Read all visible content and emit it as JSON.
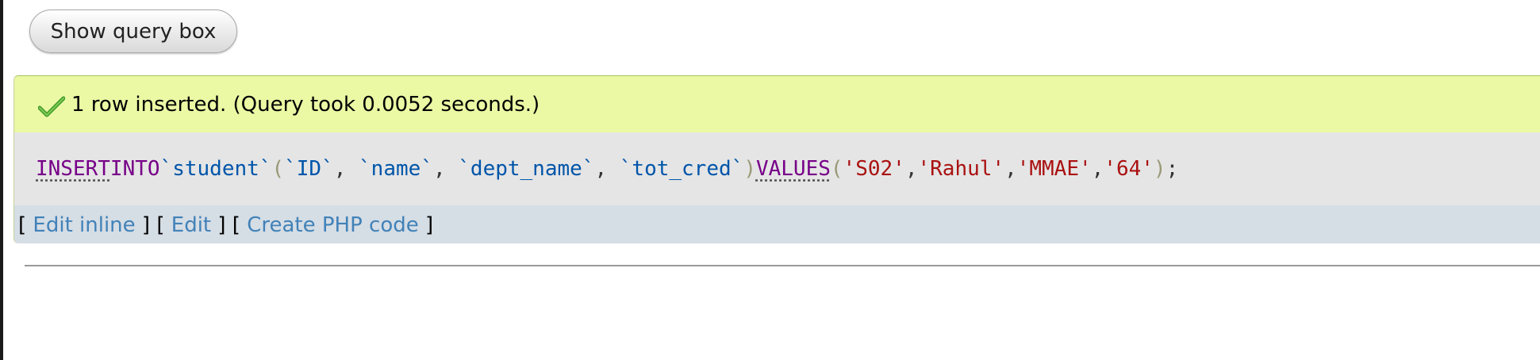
{
  "toolbar": {
    "show_query_label": "Show query box"
  },
  "result": {
    "success_message": "1 row inserted. (Query took 0.0052 seconds.)",
    "sql": {
      "kw_insert": "INSERT",
      "kw_into": "INTO",
      "table": "`student`",
      "open_paren": "(",
      "col1": "`ID`",
      "col2": "`name`",
      "col3": "`dept_name`",
      "col4": "`tot_cred`",
      "close_paren": ")",
      "kw_values": "VALUES",
      "val1": "'S02'",
      "val2": "'Rahul'",
      "val3": "'MMAE'",
      "val4": "'64'",
      "comma": ",",
      "comma_space": ", ",
      "terminator": ";"
    },
    "links": {
      "open_bracket": "[ ",
      "close_bracket": " ]",
      "separator": " ] [ ",
      "edit_inline": "Edit inline",
      "edit": "Edit",
      "create_php": "Create PHP code"
    }
  },
  "colors": {
    "success_bg": "#ebf8a4",
    "sql_bg": "#e5e5e5",
    "links_bg": "#d5dde5",
    "link_color": "#4182b8",
    "keyword": "#770088",
    "identifier": "#0055aa",
    "string": "#aa1111"
  },
  "icons": {
    "success": "check-icon"
  }
}
